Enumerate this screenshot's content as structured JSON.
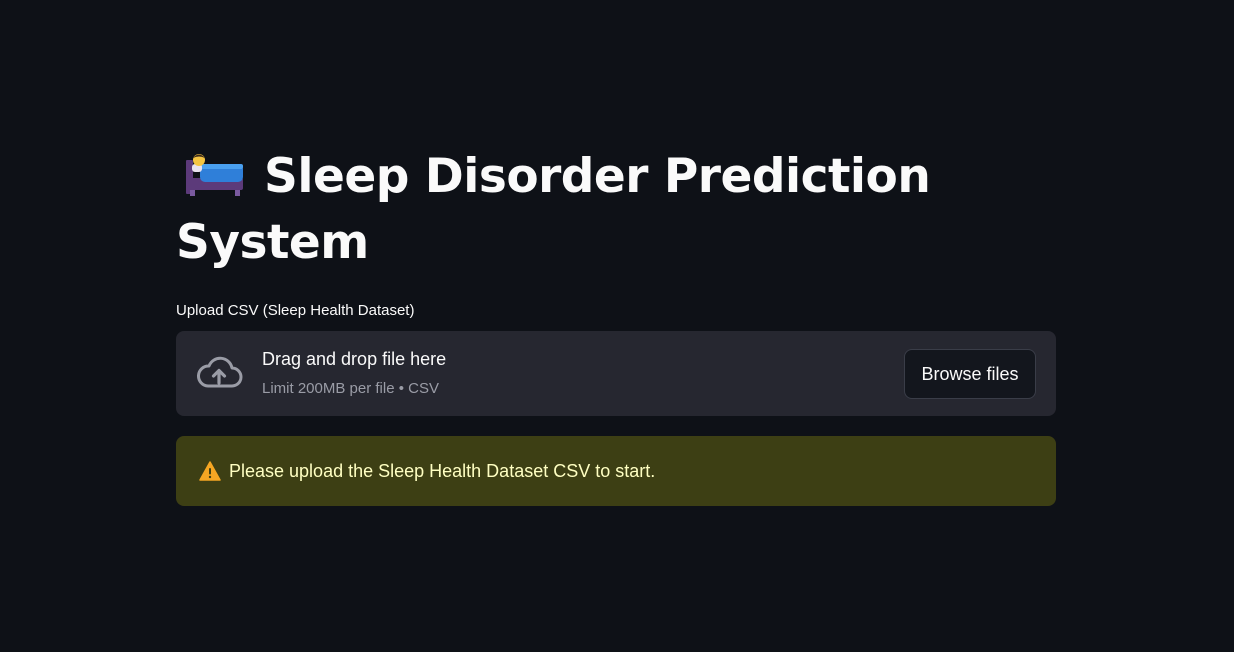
{
  "page": {
    "title": "Sleep Disorder Prediction System",
    "title_icon": "bed-with-person-emoji"
  },
  "uploader": {
    "label": "Upload CSV (Sleep Health Dataset)",
    "drop_title": "Drag and drop file here",
    "drop_subtitle": "Limit 200MB per file • CSV",
    "browse_label": "Browse files",
    "icon": "cloud-upload-icon"
  },
  "alert": {
    "type": "warning",
    "icon": "warning-icon",
    "message": "Please upload the Sleep Health Dataset CSV to start."
  },
  "colors": {
    "background": "#0e1117",
    "surface": "#262730",
    "warning_bg": "#3d3f14",
    "warning_text": "#ffffc2",
    "text": "#fafafa",
    "muted_text": "#9a9ca6"
  }
}
